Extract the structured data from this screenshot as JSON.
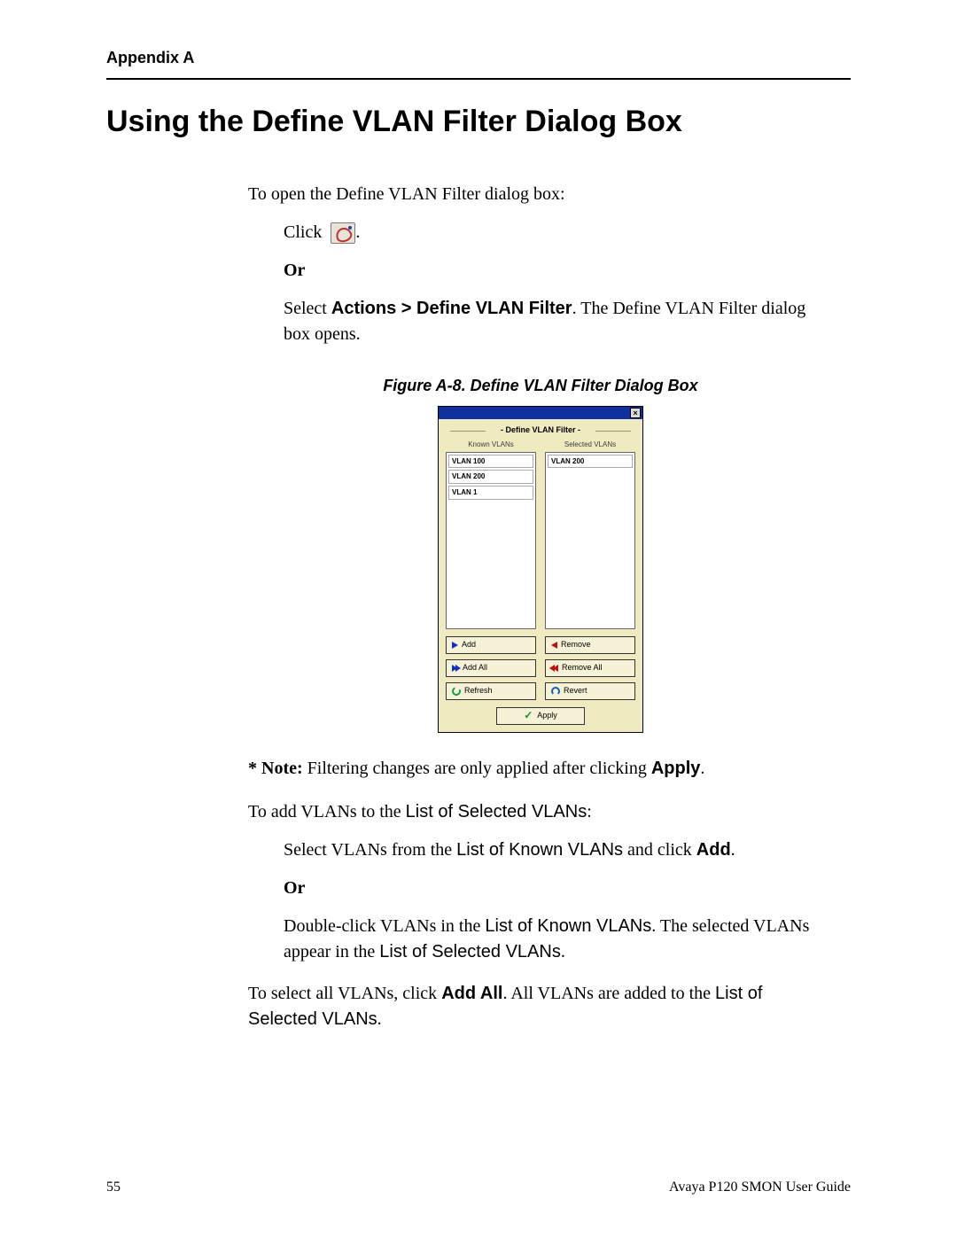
{
  "header": {
    "appendix": "Appendix A"
  },
  "title": "Using the Define VLAN Filter Dialog Box",
  "intro": "To open the Define VLAN Filter dialog box:",
  "click_label": "Click",
  "click_suffix": ".",
  "or_label": "Or",
  "select_prefix": "Select ",
  "select_menu": "Actions > Define VLAN Filter",
  "select_suffix": ". The Define VLAN Filter dialog box opens.",
  "figure_caption": "Figure A-8.  Define VLAN Filter Dialog Box",
  "dialog": {
    "title": "- Define VLAN Filter -",
    "close_glyph": "×",
    "known_label": "Known VLANs",
    "selected_label": "Selected VLANs",
    "known_items": [
      "VLAN 100",
      "VLAN 200",
      "VLAN 1"
    ],
    "selected_items": [
      "VLAN 200"
    ],
    "btn_add": "Add",
    "btn_add_all": "Add All",
    "btn_remove": "Remove",
    "btn_remove_all": "Remove All",
    "btn_refresh": "Refresh",
    "btn_revert": "Revert",
    "btn_apply": "Apply"
  },
  "note": {
    "prefix": "* Note:",
    "body": " Filtering changes are only applied after clicking ",
    "apply_word": "Apply",
    "suffix": "."
  },
  "add_intro_a": "To add VLANs to the ",
  "add_intro_b": "List of Selected VLANs",
  "add_intro_c": ":",
  "step1_a": "Select VLANs from the ",
  "step1_b": "List of Known VLANs",
  "step1_c": " and click ",
  "step1_d": "Add",
  "step1_e": ".",
  "step2_a": "Double-click VLANs in the ",
  "step2_b": "List of Known VLANs",
  "step2_c": ". The selected VLANs appear in the ",
  "step2_d": "List of Selected VLANs",
  "step2_e": ".",
  "select_all_a": "To select all VLANs, click ",
  "select_all_b": "Add All",
  "select_all_c": ". All VLANs are added to the ",
  "select_all_d": "List of Selected VLANs",
  "select_all_e": ".",
  "footer": {
    "page": "55",
    "guide": "Avaya P120 SMON User Guide"
  }
}
